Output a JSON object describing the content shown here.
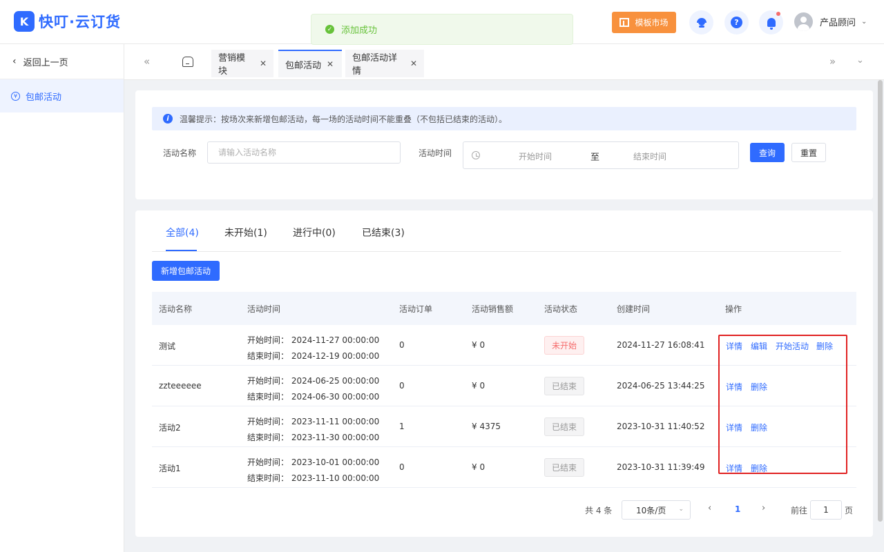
{
  "header": {
    "logo_mark": "K",
    "logo_text": "快叮·云订货",
    "toast": "添加成功",
    "market_button": "模板市场",
    "help_glyph": "?",
    "user_name": "产品顾问"
  },
  "sidebar": {
    "back_label": "返回上一页",
    "items": [
      {
        "label": "包邮活动",
        "icon": "yen-circle-icon",
        "active": true
      }
    ]
  },
  "tabs": [
    {
      "label": "营销模块",
      "active": false
    },
    {
      "label": "包邮活动",
      "active": true
    },
    {
      "label": "包邮活动详情",
      "active": false
    }
  ],
  "filter": {
    "notice": "温馨提示：按场次来新增包邮活动，每一场的活动时间不能重叠（不包括已结束的活动）。",
    "name_label": "活动名称",
    "name_placeholder": "请输入活动名称",
    "time_label": "活动时间",
    "start_placeholder": "开始时间",
    "range_separator": "至",
    "end_placeholder": "结束时间",
    "query_button": "查询",
    "reset_button": "重置"
  },
  "status_tabs": [
    {
      "label": "全部(4)",
      "active": true
    },
    {
      "label": "未开始(1)",
      "active": false
    },
    {
      "label": "进行中(0)",
      "active": false
    },
    {
      "label": "已结束(3)",
      "active": false
    }
  ],
  "add_button": "新增包邮活动",
  "table": {
    "columns": [
      "活动名称",
      "活动时间",
      "活动订单",
      "活动销售额",
      "活动状态",
      "创建时间",
      "操作"
    ],
    "start_prefix": "开始时间：",
    "end_prefix": "结束时间：",
    "rows": [
      {
        "name": "测试",
        "start": "2024-11-27 00:00:00",
        "end": "2024-12-19 00:00:00",
        "orders": "0",
        "sales": "¥ 0",
        "status": "未开始",
        "status_type": "pending",
        "created": "2024-11-27 16:08:41",
        "ops": [
          "详情",
          "编辑",
          "开始活动",
          "删除"
        ]
      },
      {
        "name": "zzteeeeee",
        "start": "2024-06-25 00:00:00",
        "end": "2024-06-30 00:00:00",
        "orders": "0",
        "sales": "¥ 0",
        "status": "已结束",
        "status_type": "ended",
        "created": "2024-06-25 13:44:25",
        "ops": [
          "详情",
          "删除"
        ]
      },
      {
        "name": "活动2",
        "start": "2023-11-11 00:00:00",
        "end": "2023-11-30 00:00:00",
        "orders": "1",
        "sales": "¥ 4375",
        "status": "已结束",
        "status_type": "ended",
        "created": "2023-10-31 11:40:52",
        "ops": [
          "详情",
          "删除"
        ]
      },
      {
        "name": "活动1",
        "start": "2023-10-01 00:00:00",
        "end": "2023-11-10 00:00:00",
        "orders": "0",
        "sales": "¥ 0",
        "status": "已结束",
        "status_type": "ended",
        "created": "2023-10-31 11:39:49",
        "ops": [
          "详情",
          "删除"
        ]
      }
    ]
  },
  "pagination": {
    "total": "共 4 条",
    "page_size": "10条/页",
    "current_page": "1",
    "goto_label": "前往",
    "goto_value": "1",
    "page_suffix": "页"
  },
  "colors": {
    "primary": "#2f6bff",
    "market": "#f8913d",
    "success": "#67c23a",
    "danger": "#f56c6c",
    "highlight": "#e02020"
  }
}
